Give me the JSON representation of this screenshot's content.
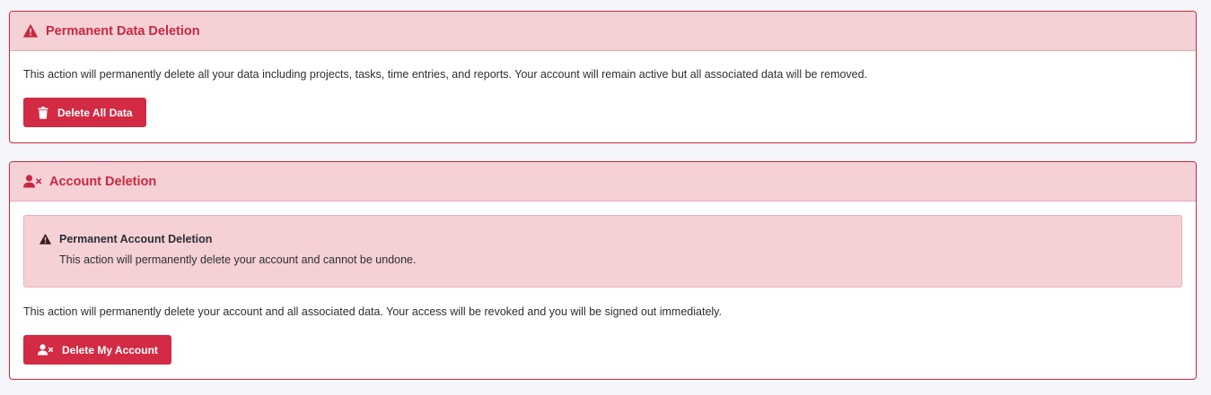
{
  "colors": {
    "danger": "#d32b43",
    "danger_title": "#c8283f",
    "header_bg": "#f5d1d6",
    "page_bg": "#f4f6fa"
  },
  "data_deletion": {
    "icon": "warning-triangle-icon",
    "title": "Permanent Data Deletion",
    "description": "This action will permanently delete all your data including projects, tasks, time entries, and reports. Your account will remain active but all associated data will be removed.",
    "button_icon": "trash-icon",
    "button_label": "Delete All Data"
  },
  "account_deletion": {
    "icon": "user-xmark-icon",
    "title": "Account Deletion",
    "alert": {
      "icon": "warning-triangle-icon",
      "title": "Permanent Account Deletion",
      "text": "This action will permanently delete your account and cannot be undone."
    },
    "description": "This action will permanently delete your account and all associated data. Your access will be revoked and you will be signed out immediately.",
    "button_icon": "user-xmark-icon",
    "button_label": "Delete My Account"
  }
}
